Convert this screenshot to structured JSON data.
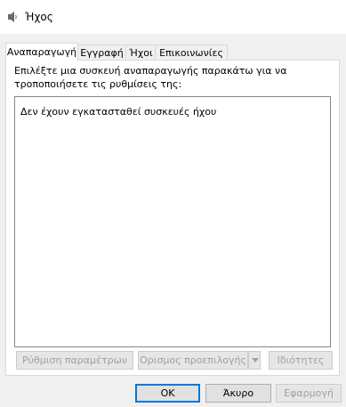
{
  "window": {
    "title": "Ήχος"
  },
  "tabs": [
    {
      "label": "Αναπαραγωγή"
    },
    {
      "label": "Εγγραφή"
    },
    {
      "label": "Ήχοι"
    },
    {
      "label": "Επικοινωνίες"
    }
  ],
  "playback": {
    "instructions": "Επιλέξτε μια συσκευή αναπαραγωγής παρακάτω για να τροποποιήσετε τις ρυθμίσεις της:",
    "empty_message": "Δεν έχουν εγκατασταθεί συσκευές ήχου",
    "configure_label": "Ρύθμιση παραμέτρων",
    "set_default_label": "Ορισμος προεπιλογής",
    "properties_label": "Ιδιότητες"
  },
  "dialog_buttons": {
    "ok_label": "OK",
    "cancel_label": "Άκυρο",
    "apply_label": "Εφαρμογή"
  }
}
